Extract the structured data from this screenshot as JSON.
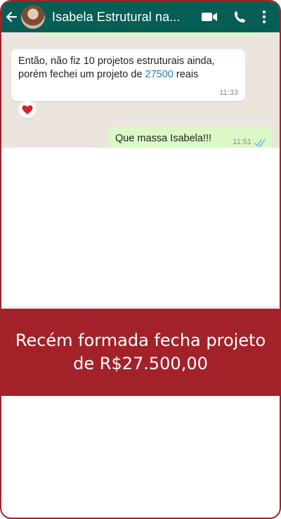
{
  "header": {
    "contact_name": "Isabela Estrutural na...",
    "icons": [
      "back-arrow-icon",
      "video-call-icon",
      "phone-icon",
      "more-vertical-icon"
    ]
  },
  "messages": [
    {
      "direction": "incoming",
      "text_before": "Então, não fiz 10 projetos estruturais ainda, porém fechei um projeto de ",
      "link_text": "27500",
      "text_after": " reais",
      "time": "11:33",
      "reaction": "heart"
    },
    {
      "direction": "outgoing",
      "text": "Que massa Isabela!!!",
      "time": "11:51",
      "status": "read"
    }
  ],
  "banner": {
    "text": "Recém formada fecha projeto de R$27.500,00"
  },
  "colors": {
    "accent": "#a3222a",
    "whatsapp_header": "#075e54",
    "chat_background": "#ece5dd",
    "outgoing_bubble": "#dcf8c6",
    "link": "#1f7fa8",
    "read_ticks": "#4fb6ec"
  }
}
